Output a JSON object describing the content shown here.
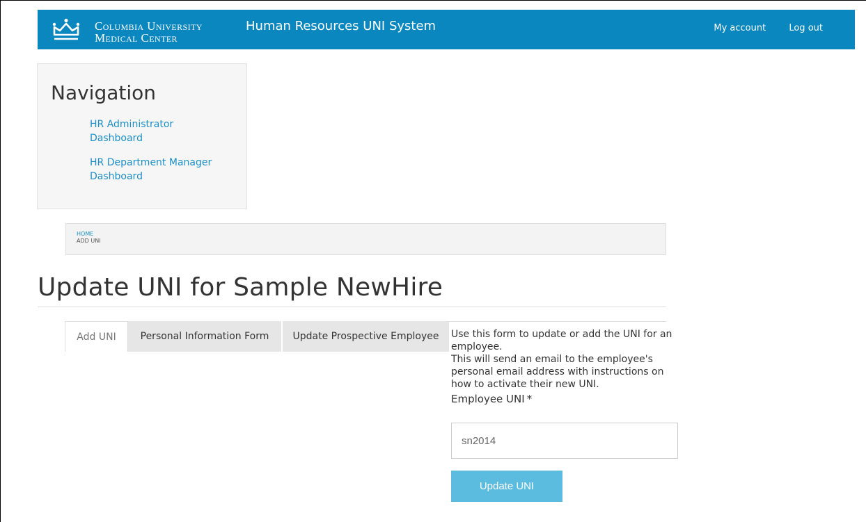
{
  "header": {
    "brand_line1": "Columbia University",
    "brand_line2": "Medical Center",
    "system_title": "Human Resources UNI System",
    "links": [
      "My account",
      "Log out"
    ],
    "bg_color": "#0a87bf",
    "logo_icon": "crown-icon"
  },
  "navigation": {
    "title": "Navigation",
    "items": [
      {
        "label": "HR Administrator Dashboard"
      },
      {
        "label": "HR Department Manager Dashboard"
      }
    ]
  },
  "breadcrumb": {
    "home": "HOME",
    "current": "ADD UNI"
  },
  "page_title": "Update UNI for Sample NewHire",
  "tabs": [
    {
      "label": "Add UNI",
      "active": true
    },
    {
      "label": "Personal Information Form",
      "active": false
    },
    {
      "label": "Update Prospective Employee",
      "active": false
    }
  ],
  "form": {
    "description_1": "Use this form to update or add the UNI for an employee.",
    "description_2": "This will send an email to the employee's personal email address with instructions on how to activate their new UNI.",
    "field_label": "Employee UNI",
    "required_mark": "*",
    "field_value": "sn2014",
    "submit_label": "Update UNI",
    "button_color": "#5bbcdf"
  }
}
